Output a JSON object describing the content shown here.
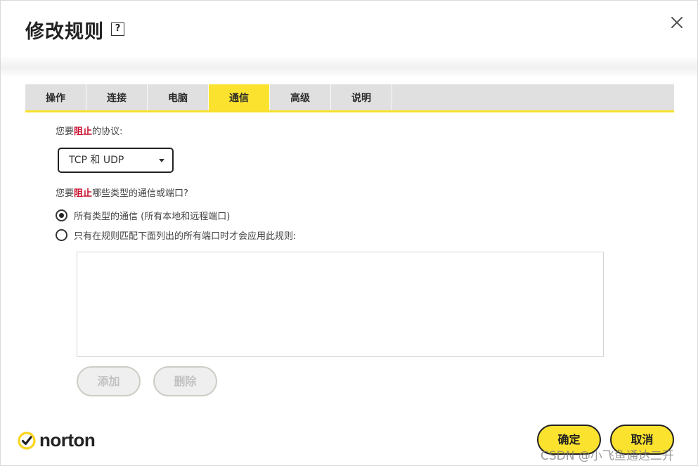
{
  "dialog": {
    "title": "修改规则",
    "help_label": "?"
  },
  "tabs": [
    {
      "label": "操作",
      "active": false
    },
    {
      "label": "连接",
      "active": false
    },
    {
      "label": "电脑",
      "active": false
    },
    {
      "label": "通信",
      "active": true
    },
    {
      "label": "高级",
      "active": false
    },
    {
      "label": "说明",
      "active": false
    }
  ],
  "protocol": {
    "prompt_prefix": "您要",
    "prompt_emphasis": "阻止",
    "prompt_suffix": "的协议:",
    "selected": "TCP 和 UDP"
  },
  "traffic": {
    "prompt_prefix": "您要",
    "prompt_emphasis": "阻止",
    "prompt_suffix": "哪些类型的通信或端口?",
    "options": [
      {
        "label": "所有类型的通信 (所有本地和远程端口)",
        "checked": true
      },
      {
        "label": "只有在规则匹配下面列出的所有端口时才会应用此规则:",
        "checked": false
      }
    ]
  },
  "ports_actions": {
    "add_label": "添加",
    "delete_label": "删除"
  },
  "footer": {
    "brand": "norton",
    "ok_label": "确定",
    "cancel_label": "取消"
  },
  "watermark": "CSDN @小飞鱼通达二开",
  "colors": {
    "accent_yellow": "#fbe22f",
    "emphasis_red": "#c8102e",
    "tab_bar": "#e0e0e0"
  }
}
